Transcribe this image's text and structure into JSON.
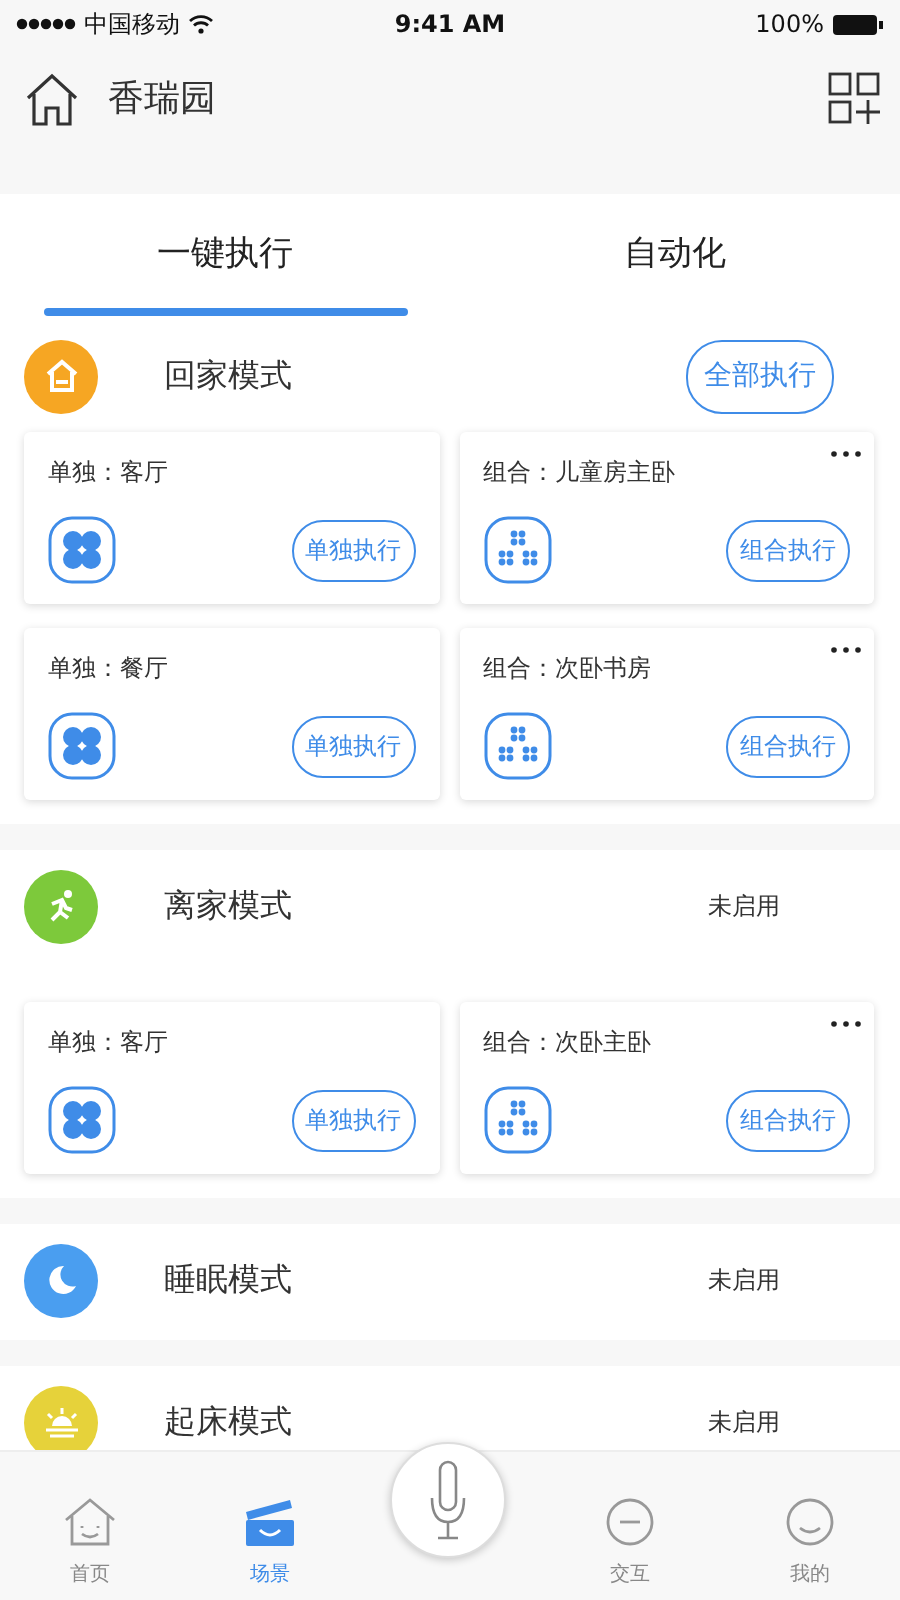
{
  "status_bar": {
    "carrier": "中国移动",
    "time": "9:41 AM",
    "battery": "100%"
  },
  "header": {
    "title": "香瑞园"
  },
  "tabs": [
    {
      "label": "一键执行",
      "selected": true
    },
    {
      "label": "自动化",
      "selected": false
    }
  ],
  "scenes": [
    {
      "name": "回家模式",
      "color": "#f6a623",
      "action": {
        "kind": "button",
        "label": "全部执行"
      },
      "tasks": [
        {
          "kind": "single",
          "label": "单独：客厅",
          "button": "单独执行"
        },
        {
          "kind": "group",
          "label": "组合：儿童房主卧",
          "button": "组合执行"
        },
        {
          "kind": "single",
          "label": "单独：餐厅",
          "button": "单独执行"
        },
        {
          "kind": "group",
          "label": "组合：次卧书房",
          "button": "组合执行"
        }
      ]
    },
    {
      "name": "离家模式",
      "color": "#7dc93b",
      "action": {
        "kind": "status",
        "label": "未启用"
      },
      "tasks": [
        {
          "kind": "single",
          "label": "单独：客厅",
          "button": "单独执行"
        },
        {
          "kind": "group",
          "label": "组合：次卧主卧",
          "button": "组合执行"
        }
      ]
    },
    {
      "name": "睡眠模式",
      "color": "#4a9ef0",
      "action": {
        "kind": "status",
        "label": "未启用"
      }
    },
    {
      "name": "起床模式",
      "color": "#e6d23a",
      "action": {
        "kind": "status",
        "label": "未启用"
      }
    }
  ],
  "tab_bar": [
    {
      "label": "首页",
      "selected": false
    },
    {
      "label": "场景",
      "selected": true
    },
    {
      "label": "交互",
      "selected": false
    },
    {
      "label": "我的",
      "selected": false
    }
  ]
}
